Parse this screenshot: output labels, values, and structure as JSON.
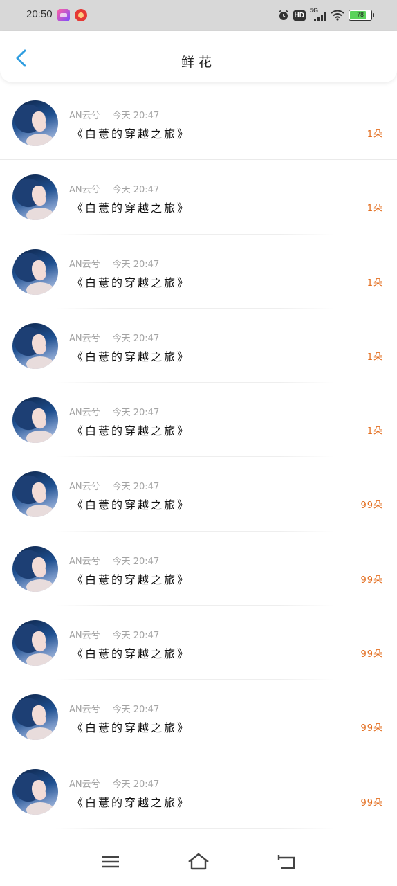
{
  "status_bar": {
    "time": "20:50",
    "network": "5G",
    "hd": "HD",
    "battery_level": 78,
    "battery_text": "78",
    "icons": [
      "app-icon-1",
      "app-icon-2",
      "alarm-icon",
      "hd-icon",
      "signal-icon",
      "wifi-icon",
      "battery-icon"
    ]
  },
  "header": {
    "title": "鲜花",
    "back_icon": "chevron-left-icon",
    "accent_color": "#2f9de0"
  },
  "list": {
    "items": [
      {
        "user": "AN云兮",
        "time": "今天 20:47",
        "book": "《白薏的穿越之旅》",
        "count": "1朵"
      },
      {
        "user": "AN云兮",
        "time": "今天 20:47",
        "book": "《白薏的穿越之旅》",
        "count": "1朵"
      },
      {
        "user": "AN云兮",
        "time": "今天 20:47",
        "book": "《白薏的穿越之旅》",
        "count": "1朵"
      },
      {
        "user": "AN云兮",
        "time": "今天 20:47",
        "book": "《白薏的穿越之旅》",
        "count": "1朵"
      },
      {
        "user": "AN云兮",
        "time": "今天 20:47",
        "book": "《白薏的穿越之旅》",
        "count": "1朵"
      },
      {
        "user": "AN云兮",
        "time": "今天 20:47",
        "book": "《白薏的穿越之旅》",
        "count": "99朵"
      },
      {
        "user": "AN云兮",
        "time": "今天 20:47",
        "book": "《白薏的穿越之旅》",
        "count": "99朵"
      },
      {
        "user": "AN云兮",
        "time": "今天 20:47",
        "book": "《白薏的穿越之旅》",
        "count": "99朵"
      },
      {
        "user": "AN云兮",
        "time": "今天 20:47",
        "book": "《白薏的穿越之旅》",
        "count": "99朵"
      },
      {
        "user": "AN云兮",
        "time": "今天 20:47",
        "book": "《白薏的穿越之旅》",
        "count": "99朵"
      }
    ],
    "count_color": "#e36d1e"
  },
  "nav_bar": {
    "buttons": [
      "menu-icon",
      "home-icon",
      "back-icon"
    ]
  }
}
